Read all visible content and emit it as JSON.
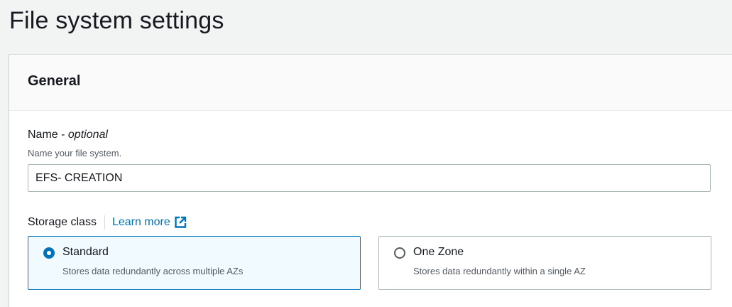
{
  "page": {
    "title": "File system settings"
  },
  "general": {
    "title": "General",
    "name_field": {
      "label": "Name - ",
      "label_optional": "optional",
      "description": "Name your file system.",
      "value": "EFS- CREATION"
    },
    "storage_class": {
      "label": "Storage class",
      "learn_more": "Learn more",
      "learn_more_icon": "external-link-icon",
      "options": [
        {
          "label": "Standard",
          "description": "Stores data redundantly across multiple AZs",
          "selected": true
        },
        {
          "label": "One Zone",
          "description": "Stores data redundantly within a single AZ",
          "selected": false
        }
      ]
    }
  },
  "colors": {
    "accent": "#0073bb",
    "selected_background": "#f1faff",
    "page_background": "#f2f3f3"
  }
}
